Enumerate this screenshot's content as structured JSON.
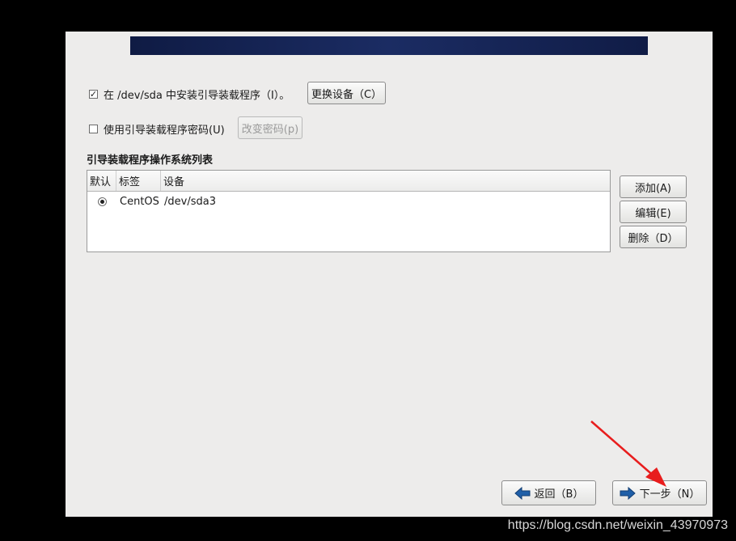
{
  "bootloader": {
    "install_label": "在 /dev/sda 中安装引导装载程序（I）。",
    "install_checked": true,
    "change_device_label": "更换设备（C）",
    "use_password_label": "使用引导装载程序密码(U)",
    "use_password_checked": false,
    "change_password_label": "改变密码(p)"
  },
  "os_list": {
    "title": "引导装载程序操作系统列表",
    "columns": [
      "默认",
      "标签",
      "设备"
    ],
    "rows": [
      {
        "default": true,
        "label": "CentOS",
        "device": "/dev/sda3"
      }
    ]
  },
  "side_buttons": {
    "add": "添加(A)",
    "edit": "编辑(E)",
    "delete": "删除（D）"
  },
  "nav": {
    "back": "返回（B）",
    "next": "下一步（N）"
  },
  "watermark": "https://blog.csdn.net/weixin_43970973",
  "colors": {
    "arrow_blue": "#1f5fa8",
    "annotation_red": "#e81d1d"
  }
}
